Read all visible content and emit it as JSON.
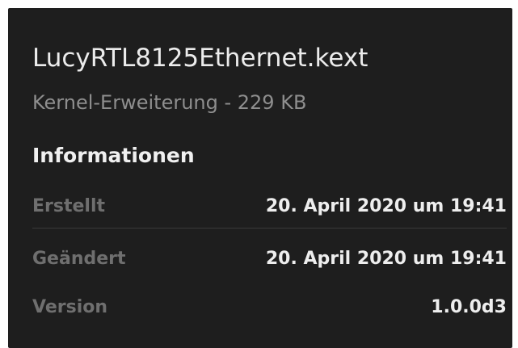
{
  "file": {
    "name": "LucyRTL8125Ethernet.kext",
    "kind_and_size": "Kernel-Erweiterung - 229 KB"
  },
  "section": {
    "heading": "Informationen"
  },
  "info_rows": [
    {
      "label": "Erstellt",
      "value": "20. April 2020 um 19:41"
    },
    {
      "label": "Geändert",
      "value": "20. April 2020 um 19:41"
    },
    {
      "label": "Version",
      "value": "1.0.0d3"
    }
  ],
  "colors": {
    "panel_background": "#1e1e1e",
    "primary_text": "#ececec",
    "secondary_text": "#8e8e8e",
    "label_text": "#6f6f6f",
    "divider": "#3a3a3a"
  }
}
